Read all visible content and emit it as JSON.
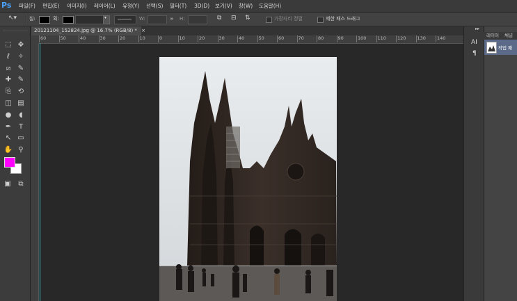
{
  "app": {
    "logo": "Ps"
  },
  "menu": [
    "파일(F)",
    "편집(E)",
    "이미지(I)",
    "레이어(L)",
    "유형(Y)",
    "선택(S)",
    "필터(T)",
    "3D(D)",
    "보기(V)",
    "창(W)",
    "도움말(H)"
  ],
  "options": {
    "fill_label": "칠:",
    "stroke_label": "획:",
    "w_label": "W:",
    "link_symbol": "⊖⊖",
    "h_label": "H:",
    "align_edges_label": "가장자리 정렬",
    "constrain_path_label": "제한 패스 드래그"
  },
  "document": {
    "tab_title": "20121104_152824.jpg @ 16.7% (RGB/8) *",
    "close": "×"
  },
  "ruler_ticks": [
    "60",
    "50",
    "40",
    "30",
    "20",
    "10",
    "0",
    "10",
    "20",
    "30",
    "40",
    "50",
    "60",
    "70",
    "80",
    "90",
    "100",
    "110",
    "120",
    "130",
    "140"
  ],
  "colors": {
    "foreground": "#ff00ff",
    "background": "#ffffff",
    "guide": "#2fbfbf"
  },
  "panels": {
    "collapse_label": "▸▸",
    "tabs": [
      "레이어",
      "채널"
    ],
    "side_icons": [
      "AI",
      "¶"
    ],
    "layer_name": "작업 패"
  },
  "tools": [
    "marquee-tool-icon",
    "move-tool-icon",
    "lasso-tool-icon",
    "magic-wand-icon",
    "crop-tool-icon",
    "eyedropper-icon",
    "spot-healing-icon",
    "brush-tool-icon",
    "clone-stamp-icon",
    "history-brush-icon",
    "eraser-icon",
    "gradient-icon",
    "blur-icon",
    "dodge-icon",
    "pen-tool-icon",
    "type-tool-icon",
    "path-select-icon",
    "shape-tool-icon",
    "hand-tool-icon",
    "zoom-tool-icon"
  ]
}
